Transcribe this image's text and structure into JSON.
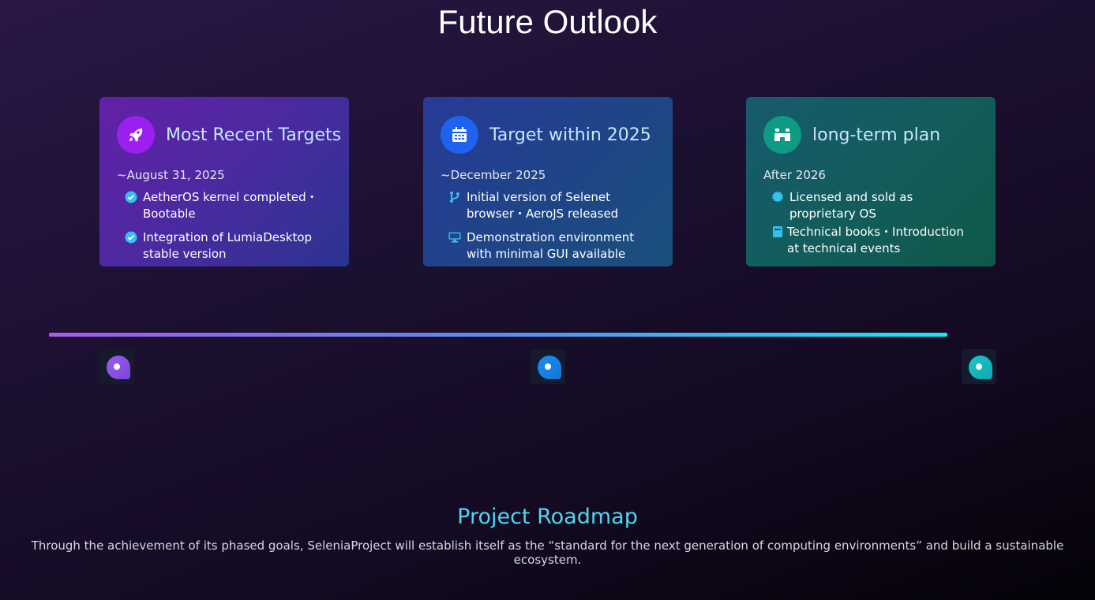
{
  "page": {
    "title": "Future Outlook"
  },
  "cards": [
    {
      "icon": "rocket-icon",
      "title": "Most Recent Targets",
      "date": "~August 31, 2025",
      "items": [
        {
          "icon": "check-circle-icon",
          "text": "AetherOS kernel completed・Bootable"
        },
        {
          "icon": "check-circle-icon",
          "text": "Integration of LumiaDesktop stable version"
        }
      ]
    },
    {
      "icon": "calendar-icon",
      "title": "Target within 2025",
      "date": "~December 2025",
      "items": [
        {
          "icon": "code-branch-icon",
          "text": "Initial version of Selenet browser・AeroJS released"
        },
        {
          "icon": "desktop-icon",
          "text": "Demonstration environment with minimal GUI available"
        }
      ]
    },
    {
      "icon": "binoculars-icon",
      "title": "long-term plan",
      "date": "After 2026",
      "items": [
        {
          "icon": "certificate-icon",
          "text": "Licensed and sold as proprietary OS"
        },
        {
          "icon": "book-icon",
          "text": "Technical books・Introduction at technical events"
        }
      ]
    }
  ],
  "timeline": {
    "colors": [
      "#a85ae8",
      "#5a8cf0",
      "#1de8f0"
    ],
    "nodes": [
      "timeline-node-1",
      "timeline-node-2",
      "timeline-node-3"
    ]
  },
  "roadmap": {
    "title": "Project Roadmap",
    "description": "Through the achievement of its phased goals, SeleniaProject will establish itself as the “standard for the next generation of computing environments” and build a sustainable ecosystem."
  }
}
